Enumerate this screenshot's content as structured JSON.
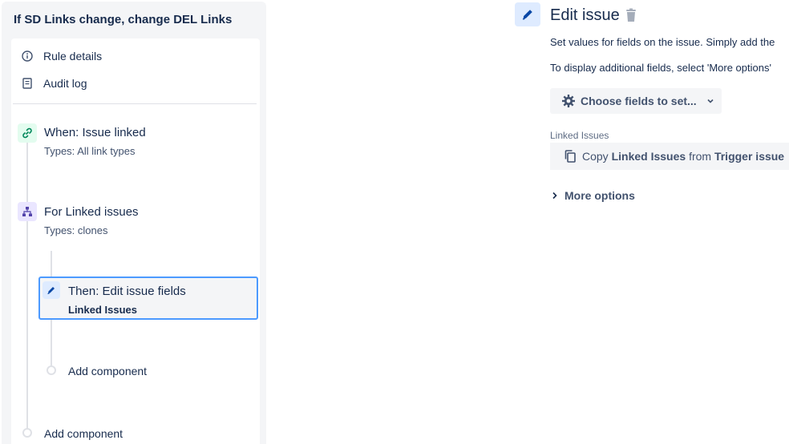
{
  "rule": {
    "title": "If SD Links change, change DEL Links",
    "menu": {
      "rule_details": "Rule details",
      "audit_log": "Audit log"
    },
    "trigger": {
      "title": "When: Issue linked",
      "subtitle": "Types: All link types",
      "icon": "link-icon"
    },
    "branch": {
      "title": "For Linked issues",
      "subtitle": "Types: clones",
      "icon": "branch-icon"
    },
    "action": {
      "title": "Then: Edit issue fields",
      "subtitle": "Linked Issues",
      "icon": "pencil-icon"
    },
    "add_component_inner": "Add component",
    "add_component_outer": "Add component"
  },
  "editor": {
    "title": "Edit issue",
    "description_1": "Set values for fields on the issue. Simply add the",
    "description_2": "To display additional fields, select 'More options'",
    "choose_fields": "Choose fields to set...",
    "field_label": "Linked Issues",
    "field_value": {
      "prefix": "Copy",
      "field": "Linked Issues",
      "middle": "from",
      "source": "Trigger issue"
    },
    "more_options": "More options"
  },
  "colors": {
    "accent": "#4c9aff",
    "trigger_bg": "#e3fcef",
    "trigger_fg": "#00875a",
    "branch_bg": "#eae6ff",
    "branch_fg": "#5243aa",
    "action_bg": "#deebff",
    "action_fg": "#0747a6"
  }
}
